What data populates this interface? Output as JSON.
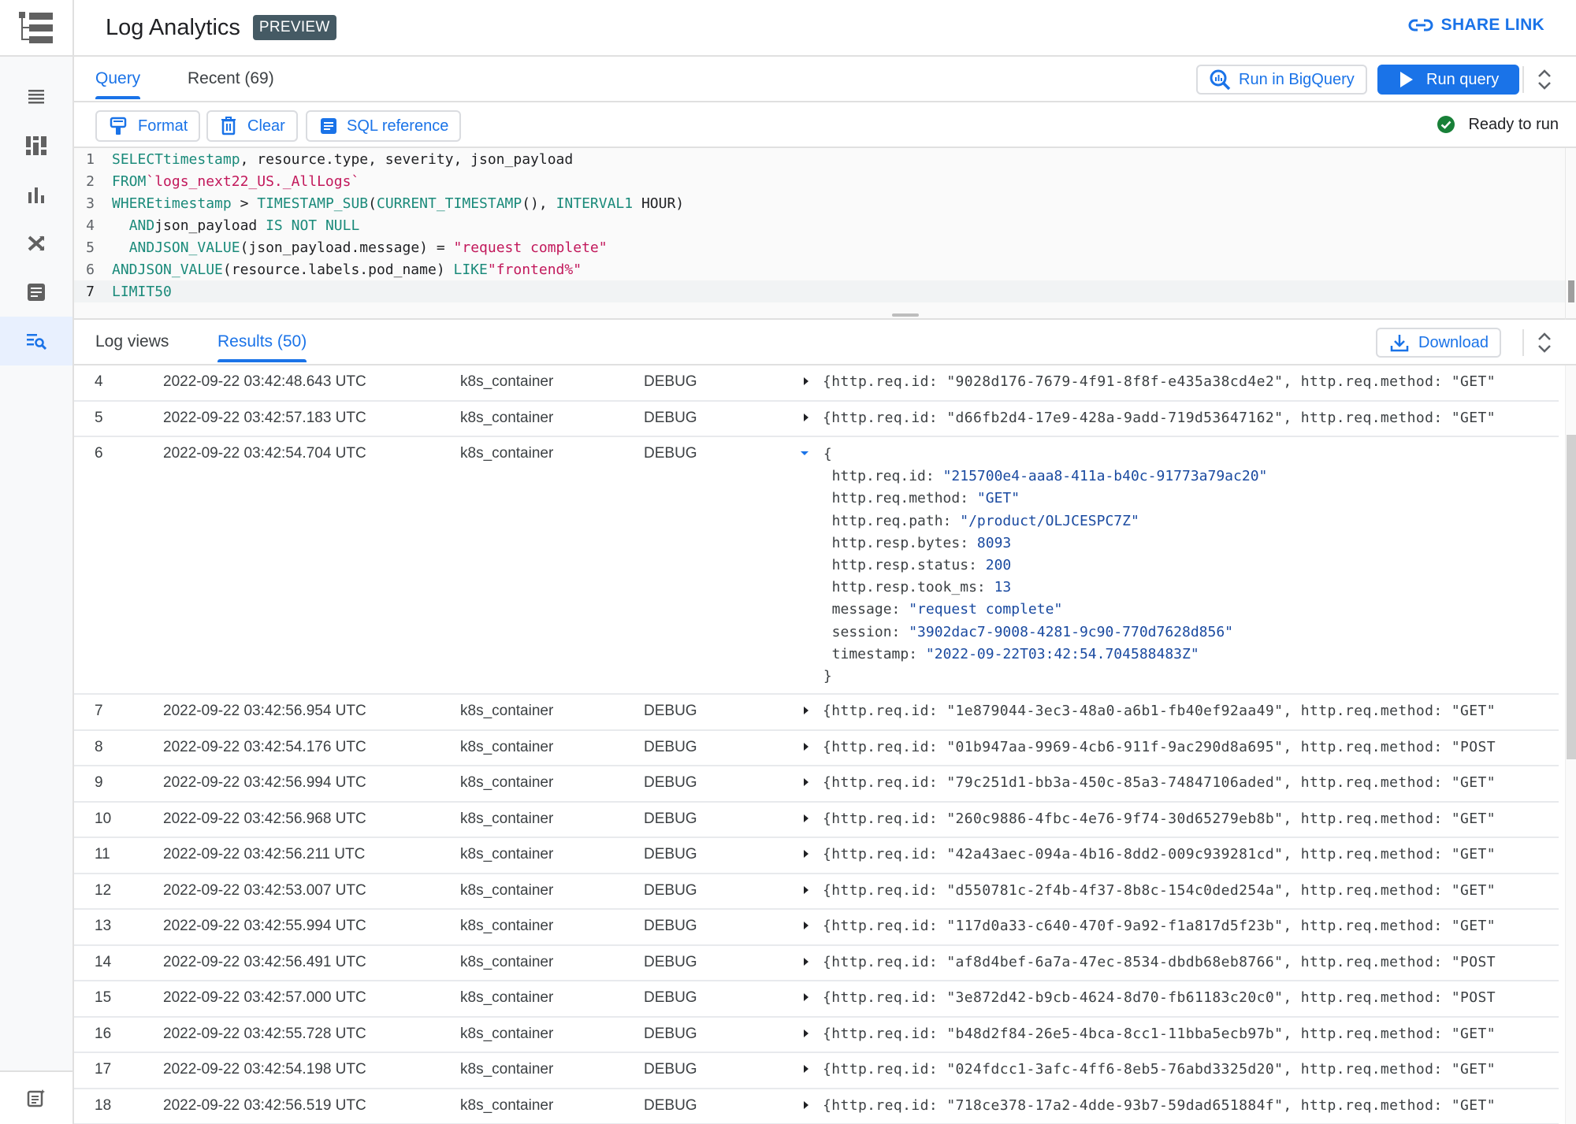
{
  "header": {
    "title": "Log Analytics",
    "badge": "PREVIEW",
    "share_link": "SHARE LINK"
  },
  "sidebar": {
    "items": [
      {
        "icon": "logs-list-icon"
      },
      {
        "icon": "dashboard-icon"
      },
      {
        "icon": "bar-chart-icon"
      },
      {
        "icon": "shuffle-router-icon"
      },
      {
        "icon": "document-icon"
      },
      {
        "icon": "log-analytics-icon",
        "active": true
      }
    ],
    "bottom_icon": "release-notes-icon"
  },
  "query_tabs": {
    "tabs": [
      {
        "label": "Query",
        "active": true
      },
      {
        "label": "Recent (69)",
        "active": false
      }
    ],
    "run_bigquery": "Run in BigQuery",
    "run_query": "Run query"
  },
  "editor_toolbar": {
    "format": "Format",
    "clear": "Clear",
    "sql_reference": "SQL reference",
    "status": "Ready to run"
  },
  "editor": {
    "lines": [
      "SELECT timestamp, resource.type, severity, json_payload",
      "FROM `logs_next22_US._AllLogs`",
      "WHERE timestamp > TIMESTAMP_SUB(CURRENT_TIMESTAMP(), INTERVAL 1 HOUR)",
      "  AND json_payload IS NOT NULL",
      "  AND JSON_VALUE(json_payload.message) = \"request complete\"",
      "AND JSON_VALUE(resource.labels.pod_name) LIKE \"frontend%\"",
      "LIMIT 50"
    ],
    "current_line": 7
  },
  "results_tabs": {
    "tabs": [
      {
        "label": "Log views",
        "active": false
      },
      {
        "label": "Results (50)",
        "active": true
      }
    ],
    "download": "Download"
  },
  "results": {
    "rows": [
      {
        "n": "4",
        "timestamp": "2022-09-22 03:42:48.643 UTC",
        "type": "k8s_container",
        "severity": "DEBUG",
        "req_id": "9028d176-7679-4f91-8f8f-e435a38cd4e2",
        "method": "\"GET\""
      },
      {
        "n": "5",
        "timestamp": "2022-09-22 03:42:57.183 UTC",
        "type": "k8s_container",
        "severity": "DEBUG",
        "req_id": "d66fb2d4-17e9-428a-9add-719d53647162",
        "method": "\"GET\""
      },
      {
        "n": "6",
        "timestamp": "2022-09-22 03:42:54.704 UTC",
        "type": "k8s_container",
        "severity": "DEBUG",
        "expanded": true
      },
      {
        "n": "7",
        "timestamp": "2022-09-22 03:42:56.954 UTC",
        "type": "k8s_container",
        "severity": "DEBUG",
        "req_id": "1e879044-3ec3-48a0-a6b1-fb40ef92aa49",
        "method": "\"GET\""
      },
      {
        "n": "8",
        "timestamp": "2022-09-22 03:42:54.176 UTC",
        "type": "k8s_container",
        "severity": "DEBUG",
        "req_id": "01b947aa-9969-4cb6-911f-9ac290d8a695",
        "method": "\"POST"
      },
      {
        "n": "9",
        "timestamp": "2022-09-22 03:42:56.994 UTC",
        "type": "k8s_container",
        "severity": "DEBUG",
        "req_id": "79c251d1-bb3a-450c-85a3-74847106aded",
        "method": "\"GET\""
      },
      {
        "n": "10",
        "timestamp": "2022-09-22 03:42:56.968 UTC",
        "type": "k8s_container",
        "severity": "DEBUG",
        "req_id": "260c9886-4fbc-4e76-9f74-30d65279eb8b",
        "method": "\"GET\""
      },
      {
        "n": "11",
        "timestamp": "2022-09-22 03:42:56.211 UTC",
        "type": "k8s_container",
        "severity": "DEBUG",
        "req_id": "42a43aec-094a-4b16-8dd2-009c939281cd",
        "method": "\"GET\""
      },
      {
        "n": "12",
        "timestamp": "2022-09-22 03:42:53.007 UTC",
        "type": "k8s_container",
        "severity": "DEBUG",
        "req_id": "d550781c-2f4b-4f37-8b8c-154c0ded254a",
        "method": "\"GET\""
      },
      {
        "n": "13",
        "timestamp": "2022-09-22 03:42:55.994 UTC",
        "type": "k8s_container",
        "severity": "DEBUG",
        "req_id": "117d0a33-c640-470f-9a92-f1a817d5f23b",
        "method": "\"GET\""
      },
      {
        "n": "14",
        "timestamp": "2022-09-22 03:42:56.491 UTC",
        "type": "k8s_container",
        "severity": "DEBUG",
        "req_id": "af8d4bef-6a7a-47ec-8534-dbdb68eb8766",
        "method": "\"POST"
      },
      {
        "n": "15",
        "timestamp": "2022-09-22 03:42:57.000 UTC",
        "type": "k8s_container",
        "severity": "DEBUG",
        "req_id": "3e872d42-b9cb-4624-8d70-fb61183c20c0",
        "method": "\"POST"
      },
      {
        "n": "16",
        "timestamp": "2022-09-22 03:42:55.728 UTC",
        "type": "k8s_container",
        "severity": "DEBUG",
        "req_id": "b48d2f84-26e5-4bca-8cc1-11bba5ecb97b",
        "method": "\"GET\""
      },
      {
        "n": "17",
        "timestamp": "2022-09-22 03:42:54.198 UTC",
        "type": "k8s_container",
        "severity": "DEBUG",
        "req_id": "024fdcc1-3afc-4ff6-8eb5-76abd3325d20",
        "method": "\"GET\""
      },
      {
        "n": "18",
        "timestamp": "2022-09-22 03:42:56.519 UTC",
        "type": "k8s_container",
        "severity": "DEBUG",
        "req_id": "718ce378-17a2-4dde-93b7-59dad651884f",
        "method": "\"GET\""
      }
    ],
    "expanded_payload": [
      {
        "key": "http.req.id",
        "value": "\"215700e4-aaa8-411a-b40c-91773a79ac20\""
      },
      {
        "key": "http.req.method",
        "value": "\"GET\""
      },
      {
        "key": "http.req.path",
        "value": "\"/product/OLJCESPC7Z\""
      },
      {
        "key": "http.resp.bytes",
        "value": "8093"
      },
      {
        "key": "http.resp.status",
        "value": "200"
      },
      {
        "key": "http.resp.took_ms",
        "value": "13"
      },
      {
        "key": "message",
        "value": "\"request complete\""
      },
      {
        "key": "session",
        "value": "\"3902dac7-9008-4281-9c90-770d7628d856\""
      },
      {
        "key": "timestamp",
        "value": "\"2022-09-22T03:42:54.704588483Z\""
      }
    ]
  },
  "colors": {
    "accent": "#1a73e8",
    "badge_bg": "#455a64",
    "success": "#188038",
    "sql_keyword": "#1a8a7a",
    "sql_string": "#c2185b",
    "json_value": "#1a4aa0"
  }
}
